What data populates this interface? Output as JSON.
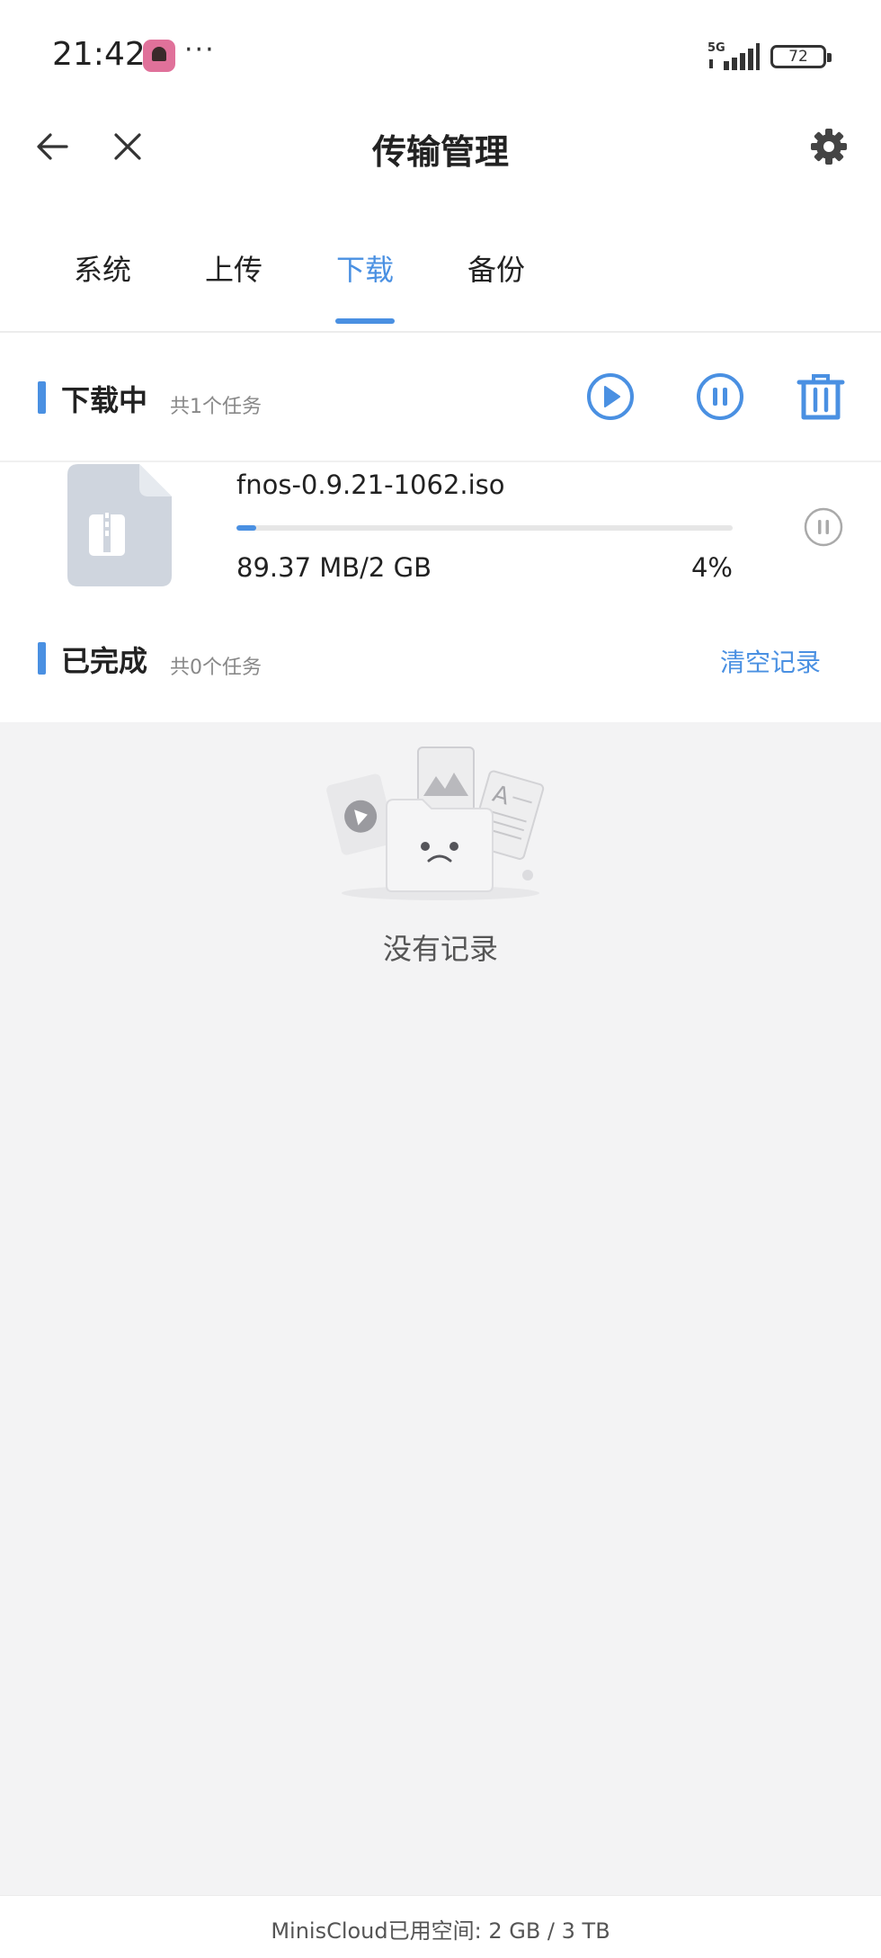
{
  "status_bar": {
    "time": "21:42",
    "more": "···",
    "network": "5G",
    "battery": "72"
  },
  "header": {
    "title": "传输管理",
    "back_icon": "back-arrow-icon",
    "close_icon": "close-icon",
    "settings_icon": "gear-icon"
  },
  "tabs": [
    {
      "label": "系统",
      "active": false
    },
    {
      "label": "上传",
      "active": false
    },
    {
      "label": "下载",
      "active": true
    },
    {
      "label": "备份",
      "active": false
    }
  ],
  "downloading": {
    "title": "下载中",
    "count": "共1个任务",
    "actions": [
      "play-all-icon",
      "pause-all-icon",
      "trash-icon"
    ],
    "items": [
      {
        "name": "fnos-0.9.21-1062.iso",
        "size": "89.37 MB/2 GB",
        "percent": "4%",
        "progress": 0.04
      }
    ]
  },
  "completed": {
    "title": "已完成",
    "count": "共0个任务",
    "clear_label": "清空记录"
  },
  "empty_state": {
    "text": "没有记录"
  },
  "footer": {
    "storage": "MinisCloud已用空间: 2 GB / 3 TB"
  },
  "colors": {
    "accent": "#4a90e2",
    "background": "#f3f3f4"
  }
}
